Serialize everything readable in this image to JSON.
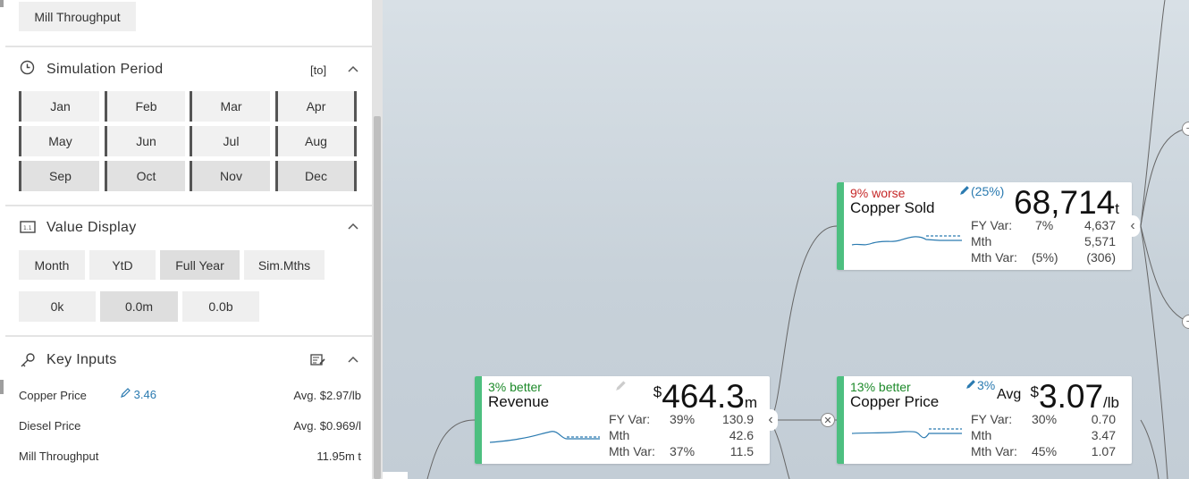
{
  "panel": {
    "top_button": "Mill Throughput",
    "simulation": {
      "title": "Simulation Period",
      "to_label": "[to]",
      "months": [
        "Jan",
        "Feb",
        "Mar",
        "Apr",
        "May",
        "Jun",
        "Jul",
        "Aug",
        "Sep",
        "Oct",
        "Nov",
        "Dec"
      ],
      "selected_months": [
        "Sep",
        "Oct",
        "Nov",
        "Dec"
      ]
    },
    "value_display": {
      "title": "Value Display",
      "period_buttons": [
        "Month",
        "YtD",
        "Full Year",
        "Sim.Mths"
      ],
      "active_period": "Full Year",
      "scale_buttons": [
        "0k",
        "0.0m",
        "0.0b"
      ],
      "active_scale": "0.0m"
    },
    "key_inputs": {
      "title": "Key Inputs",
      "rows": [
        {
          "label": "Copper Price",
          "edit": "3.46",
          "value": "Avg. $2.97/lb"
        },
        {
          "label": "Diesel Price",
          "edit": "",
          "value": "Avg. $0.969/l"
        },
        {
          "label": "Mill Throughput",
          "edit": "",
          "value": "11.95m t"
        }
      ]
    }
  },
  "cards": {
    "copper_sold": {
      "status": "9% worse",
      "edit": "(25%)",
      "name": "Copper Sold",
      "value": "68,714",
      "unit": "t",
      "fy_label": "FY Var:",
      "fy_pct": "7%",
      "fy_val": "4,637",
      "mth_label": "Mth",
      "mth_val": "5,571",
      "mthvar_label": "Mth Var:",
      "mthvar_pct": "(5%)",
      "mthvar_val": "(306)"
    },
    "revenue": {
      "status": "3% better",
      "name": "Revenue",
      "currency": "$",
      "value": "464.3",
      "unit": "m",
      "fy_label": "FY Var:",
      "fy_pct": "39%",
      "fy_val": "130.9",
      "mth_label": "Mth",
      "mth_val": "42.6",
      "mthvar_label": "Mth Var:",
      "mthvar_pct": "37%",
      "mthvar_val": "11.5"
    },
    "copper_price": {
      "status": "13% better",
      "edit": "3%",
      "name": "Copper Price",
      "prefix": "Avg",
      "currency": "$",
      "value": "3.07",
      "unit": "/lb",
      "fy_label": "FY Var:",
      "fy_pct": "30%",
      "fy_val": "0.70",
      "mth_label": "Mth",
      "mth_val": "3.47",
      "mthvar_label": "Mth Var:",
      "mthvar_pct": "45%",
      "mthvar_val": "1.07"
    }
  },
  "colors": {
    "good": "#1d8a2a",
    "bad": "#c62828",
    "accent": "#2a7ab0",
    "bar": "#4dbf80"
  },
  "icons": {
    "simulation": "clock-icon",
    "value_display": "display-icon",
    "key_inputs": "key-icon",
    "edit": "pencil-icon"
  }
}
